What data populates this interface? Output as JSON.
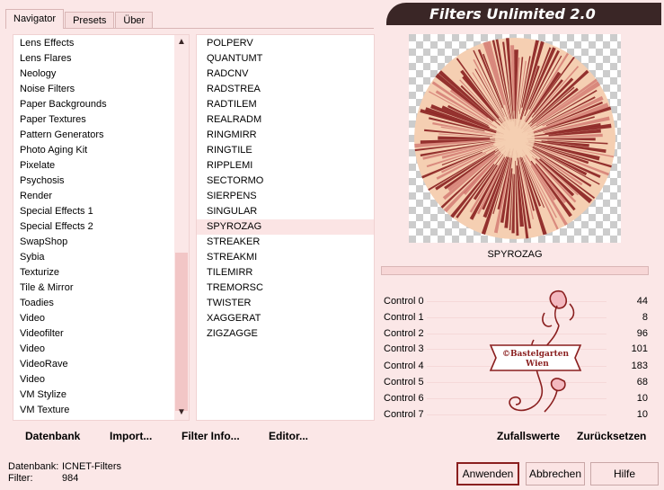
{
  "app": {
    "title": "Filters Unlimited 2.0"
  },
  "tabs": [
    {
      "label": "Navigator",
      "active": true
    },
    {
      "label": "Presets",
      "active": false
    },
    {
      "label": "Über",
      "active": false
    }
  ],
  "categories": [
    "Lens Effects",
    "Lens Flares",
    "Neology",
    "Noise Filters",
    "Paper Backgrounds",
    "Paper Textures",
    "Pattern Generators",
    "Photo Aging Kit",
    "Pixelate",
    "Psychosis",
    "Render",
    "Special Effects 1",
    "Special Effects 2",
    "SwapShop",
    "Sybia",
    "Texturize",
    "Tile & Mirror",
    "Toadies",
    "Video",
    "Videofilter",
    "Video",
    "VideoRave",
    "Video",
    "VM Stylize",
    "VM Texture"
  ],
  "selected_category": "Sybia",
  "filters": [
    "POLPERV",
    "QUANTUMT",
    "RADCNV",
    "RADSTREA",
    "RADTILEM",
    "REALRADM",
    "RINGMIRR",
    "RINGTILE",
    "RIPPLEMI",
    "SECTORMO",
    "SIERPENS",
    "SINGULAR",
    "SPYROZAG",
    "STREAKER",
    "STREAKMI",
    "TILEMIRR",
    "TREMORSC",
    "TWISTER",
    "XAGGERAT",
    "ZIGZAGGE"
  ],
  "selected_filter": "SPYROZAG",
  "preview": {
    "filter_name": "SPYROZAG"
  },
  "controls": [
    {
      "label": "Control 0",
      "value": "44"
    },
    {
      "label": "Control 1",
      "value": "8"
    },
    {
      "label": "Control 2",
      "value": "96"
    },
    {
      "label": "Control 3",
      "value": "101"
    },
    {
      "label": "Control 4",
      "value": "183"
    },
    {
      "label": "Control 5",
      "value": "68"
    },
    {
      "label": "Control 6",
      "value": "10"
    },
    {
      "label": "Control 7",
      "value": "10"
    }
  ],
  "logo": {
    "line1": "©Bastelgarten",
    "line2": "Wien"
  },
  "toolbar": {
    "database": "Datenbank",
    "import": "Import...",
    "filter_info": "Filter Info...",
    "editor": "Editor...",
    "random": "Zufallswerte",
    "reset": "Zurücksetzen"
  },
  "status": {
    "database_label": "Datenbank:",
    "database_value": "ICNET-Filters",
    "filter_label": "Filter:",
    "filter_value": "984"
  },
  "buttons": {
    "apply": "Anwenden",
    "cancel": "Abbrechen",
    "help": "Hilfe"
  },
  "colors": {
    "background": "#fbe7e7",
    "banner": "#3a2626",
    "accent": "#8a1f1f",
    "preview_base": "#f5cfb2"
  }
}
